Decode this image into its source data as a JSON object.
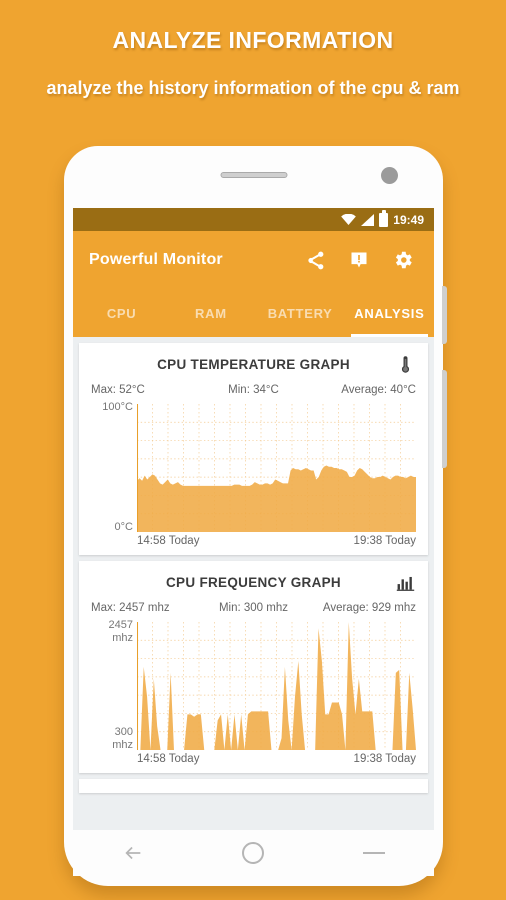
{
  "promo": {
    "title": "ANALYZE INFORMATION",
    "subtitle": "analyze the history information of the cpu & ram"
  },
  "statusbar": {
    "time": "19:49",
    "icons": [
      "wifi-icon",
      "signal-icon",
      "battery-icon"
    ]
  },
  "toolbar": {
    "app_title": "Powerful Monitor",
    "actions": [
      {
        "name": "share-icon",
        "label": "Share"
      },
      {
        "name": "alert-icon",
        "label": "Alerts"
      },
      {
        "name": "gear-icon",
        "label": "Settings"
      }
    ]
  },
  "tabs": [
    {
      "label": "CPU",
      "active": false
    },
    {
      "label": "RAM",
      "active": false
    },
    {
      "label": "BATTERY",
      "active": false
    },
    {
      "label": "ANALYSIS",
      "active": true
    }
  ],
  "cards": [
    {
      "title": "CPU TEMPERATURE GRAPH",
      "icon": "thermometer-icon",
      "max": "Max: 52°C",
      "min": "Min: 34°C",
      "average": "Average: 40°C",
      "y_top": "100°C",
      "y_bottom": "0°C",
      "x_start": "14:58 Today",
      "x_end": "19:38 Today"
    },
    {
      "title": "CPU FREQUENCY GRAPH",
      "icon": "bar-chart-icon",
      "max": "Max: 2457 mhz",
      "min": "Min: 300 mhz",
      "average": "Average: 929 mhz",
      "y_top": "2457\nmhz",
      "y_top_l1": "2457",
      "y_top_l2": "mhz",
      "y_bottom_l1": "300",
      "y_bottom_l2": "mhz",
      "x_start": "14:58 Today",
      "x_end": "19:38 Today"
    }
  ],
  "navbar": [
    {
      "name": "nav-back-icon",
      "label": "Back"
    },
    {
      "name": "nav-home-icon",
      "label": "Home"
    },
    {
      "name": "nav-recents-icon",
      "label": "Recents"
    }
  ],
  "colors": {
    "brand_orange": "#efa430",
    "statusbar_brown": "#9a6d14",
    "chart_fill": "#f0ab46",
    "card_bg": "#ffffff",
    "content_bg": "#eceff1"
  },
  "chart_data": [
    {
      "type": "area",
      "title": "CPU TEMPERATURE GRAPH",
      "ylabel": "°C",
      "xlabel": "",
      "ylim": [
        0,
        100
      ],
      "ytick_labels": [
        "0°C",
        "100°C"
      ],
      "xtick_labels": [
        "14:58 Today",
        "19:38 Today"
      ],
      "grid": true,
      "legend": "none",
      "stats": {
        "max": 52,
        "min": 34,
        "average": 40,
        "unit": "°C"
      },
      "values": [
        40,
        42,
        40,
        44,
        41,
        43,
        45,
        44,
        41,
        38,
        37,
        39,
        41,
        38,
        37,
        38,
        39,
        37,
        36,
        36,
        36,
        36,
        36,
        36,
        36,
        36,
        36,
        36,
        36,
        36,
        36,
        36,
        36,
        36,
        36,
        36,
        36,
        36,
        37,
        37,
        37,
        36,
        36,
        36,
        36,
        37,
        39,
        38,
        37,
        37,
        38,
        38,
        37,
        38,
        41,
        40,
        39,
        38,
        38,
        38,
        48,
        50,
        49,
        49,
        48,
        49,
        50,
        49,
        48,
        48,
        41,
        43,
        48,
        51,
        52,
        51,
        51,
        50,
        50,
        49,
        49,
        48,
        47,
        43,
        43,
        44,
        48,
        50,
        49,
        47,
        45,
        43,
        42,
        42,
        43,
        43,
        44,
        43,
        42,
        41,
        43,
        44,
        44,
        43,
        43,
        42,
        43,
        44,
        43,
        43
      ]
    },
    {
      "type": "area",
      "title": "CPU FREQUENCY GRAPH",
      "ylabel": "mhz",
      "xlabel": "",
      "ylim": [
        300,
        2457
      ],
      "ytick_labels": [
        "300 mhz",
        "2457 mhz"
      ],
      "xtick_labels": [
        "14:58 Today",
        "19:38 Today"
      ],
      "grid": true,
      "legend": "none",
      "stats": {
        "max": 2457,
        "min": 300,
        "average": 929,
        "unit": "mhz"
      },
      "values": [
        300,
        300,
        1700,
        1200,
        300,
        1500,
        700,
        300,
        300,
        300,
        1600,
        300,
        300,
        300,
        300,
        900,
        900,
        860,
        900,
        900,
        300,
        300,
        300,
        300,
        800,
        900,
        300,
        900,
        300,
        900,
        300,
        900,
        300,
        900,
        950,
        950,
        950,
        950,
        950,
        950,
        300,
        300,
        300,
        500,
        1700,
        800,
        300,
        1200,
        1800,
        900,
        300,
        300,
        300,
        300,
        2350,
        1800,
        900,
        900,
        1100,
        1100,
        1100,
        900,
        300,
        2457,
        1500,
        900,
        1500,
        950,
        950,
        950,
        950,
        300,
        300,
        300,
        300,
        300,
        300,
        1600,
        1650,
        300,
        300,
        1600,
        1000,
        300
      ]
    }
  ]
}
